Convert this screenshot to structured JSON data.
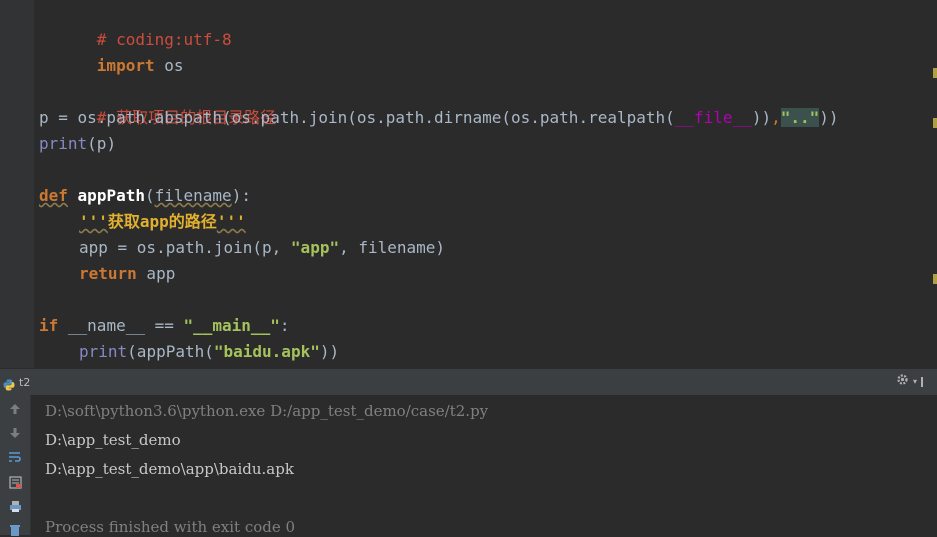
{
  "editor": {
    "lines": [
      [
        "# coding:utf-8"
      ],
      [
        "import",
        " os"
      ],
      [
        ""
      ],
      [
        "# 获取项目的根目录路径"
      ],
      [
        "p = os.path.abspath(os.path.join(os.path.dirname(os.path.realpath(",
        "__file__",
        "))",
        ",",
        "\"..\"",
        "))"
      ],
      [
        "print",
        "(p)"
      ],
      [
        ""
      ],
      [
        "def",
        " ",
        "appPath",
        "(",
        "filename",
        "):"
      ],
      [
        "'''",
        "获取app的路径",
        "'''"
      ],
      [
        "app = os.path.join(p, ",
        "\"app\"",
        ", filename)"
      ],
      [
        "return",
        " app"
      ],
      [
        ""
      ],
      [
        "if",
        " ",
        "__name__",
        " == ",
        "\"__main__\"",
        ":"
      ],
      [
        "print",
        "(appPath(",
        "\"baidu.apk\"",
        "))"
      ]
    ]
  },
  "run_panel": {
    "tab_label": "t2",
    "settings_icon": "gear-icon",
    "toolbar_icons": [
      "arrow-up-icon",
      "arrow-down-icon",
      "soft-wrap-icon",
      "scroll-to-end-icon",
      "print-icon",
      "trash-icon"
    ],
    "console_lines": [
      "D:\\soft\\python3.6\\python.exe D:/app_test_demo/case/t2.py",
      "D:\\app_test_demo",
      "D:\\app_test_demo\\app\\baidu.apk",
      "",
      "Process finished with exit code 0"
    ]
  },
  "colors": {
    "editor_bg": "#2b2b2b",
    "keyword": "#cc7832",
    "comment": "#cc4c3d",
    "string": "#a5c25c",
    "docstring": "#e0b02e",
    "builtin": "#8888c6"
  }
}
